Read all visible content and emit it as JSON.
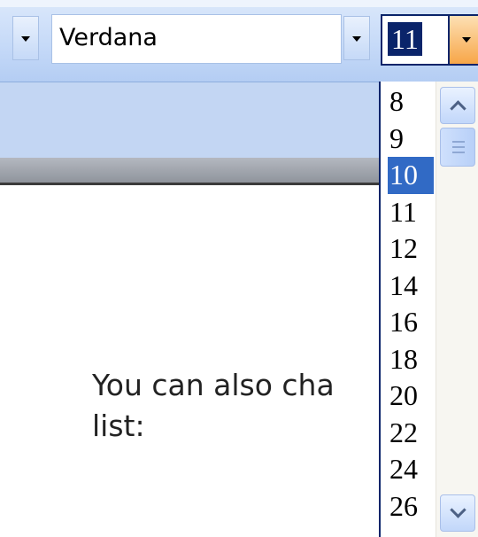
{
  "toolbar": {
    "font_name": "Verdana",
    "font_size": "11"
  },
  "document": {
    "line1": "You can also cha",
    "line2": "list:"
  },
  "size_list": {
    "options": [
      "8",
      "9",
      "10",
      "11",
      "12",
      "14",
      "16",
      "18",
      "20",
      "22",
      "24",
      "26"
    ],
    "selected": "10"
  },
  "icons": {
    "dropdown_arrow": "chevron-down-icon",
    "scroll_up": "chevron-up-icon",
    "scroll_down": "chevron-down-icon",
    "scroll_thumb": "grip-icon"
  },
  "colors": {
    "selection": "#316ac5",
    "focus_border": "#0a246a",
    "hot_button": "#f7a648",
    "toolbar": "#c6daf8"
  }
}
